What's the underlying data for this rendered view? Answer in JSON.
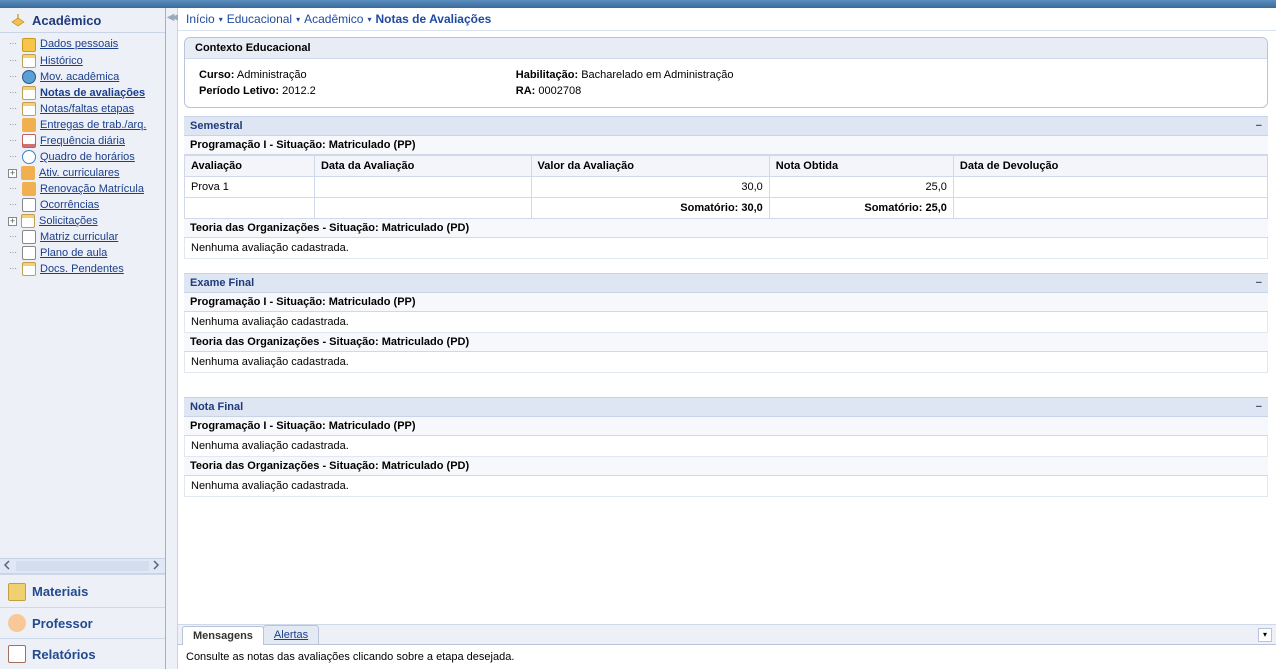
{
  "breadcrumb": {
    "items": [
      "Início",
      "Educacional",
      "Acadêmico"
    ],
    "current": "Notas de Avaliações"
  },
  "sidebar": {
    "active_section": "Acadêmico",
    "nav": [
      {
        "label": "Dados pessoais",
        "expandable": false
      },
      {
        "label": "Histórico",
        "expandable": false
      },
      {
        "label": "Mov. acadêmica",
        "expandable": false
      },
      {
        "label": "Notas de avaliações",
        "expandable": false,
        "active": true
      },
      {
        "label": "Notas/faltas etapas",
        "expandable": false
      },
      {
        "label": "Entregas de trab./arq.",
        "expandable": false
      },
      {
        "label": "Frequência diária",
        "expandable": false
      },
      {
        "label": "Quadro de horários",
        "expandable": false
      },
      {
        "label": "Ativ. curriculares",
        "expandable": true
      },
      {
        "label": "Renovação Matrícula",
        "expandable": false
      },
      {
        "label": "Ocorrências",
        "expandable": false
      },
      {
        "label": "Solicitações",
        "expandable": true
      },
      {
        "label": "Matriz curricular",
        "expandable": false
      },
      {
        "label": "Plano de aula",
        "expandable": false
      },
      {
        "label": "Docs. Pendentes",
        "expandable": false
      }
    ],
    "accordion": [
      "Materiais",
      "Professor",
      "Relatórios"
    ]
  },
  "context": {
    "title": "Contexto Educacional",
    "curso_label": "Curso:",
    "curso_value": "Administração",
    "periodo_label": "Período Letivo:",
    "periodo_value": "2012.2",
    "habilitacao_label": "Habilitação:",
    "habilitacao_value": "Bacharelado em Administração",
    "ra_label": "RA:",
    "ra_value": "0002708"
  },
  "sections": {
    "semestral": {
      "title": "Semestral",
      "prog1": {
        "header": "Programação I - Situação: Matriculado (PP)",
        "cols": [
          "Avaliação",
          "Data da Avaliação",
          "Valor da Avaliação",
          "Nota Obtida",
          "Data de Devolução"
        ],
        "row": {
          "avaliacao": "Prova 1",
          "data": "",
          "valor": "30,0",
          "nota": "25,0",
          "devolucao": ""
        },
        "sum_valor": "Somatório: 30,0",
        "sum_nota": "Somatório: 25,0"
      },
      "teoria": {
        "header": "Teoria das Organizações - Situação: Matriculado (PD)",
        "msg": "Nenhuma avaliação cadastrada."
      }
    },
    "examefinal": {
      "title": "Exame Final",
      "prog1": {
        "header": "Programação I - Situação: Matriculado (PP)",
        "msg": "Nenhuma avaliação cadastrada."
      },
      "teoria": {
        "header": "Teoria das Organizações - Situação: Matriculado (PD)",
        "msg": "Nenhuma avaliação cadastrada."
      }
    },
    "notafinal": {
      "title": "Nota Final",
      "prog1": {
        "header": "Programação I - Situação: Matriculado (PP)",
        "msg": "Nenhuma avaliação cadastrada."
      },
      "teoria": {
        "header": "Teoria das Organizações - Situação: Matriculado (PD)",
        "msg": "Nenhuma avaliação cadastrada."
      }
    }
  },
  "footer": {
    "tabs": {
      "mensagens": "Mensagens",
      "alertas": "Alertas"
    },
    "message": "Consulte as notas das avaliações clicando sobre a etapa desejada."
  }
}
